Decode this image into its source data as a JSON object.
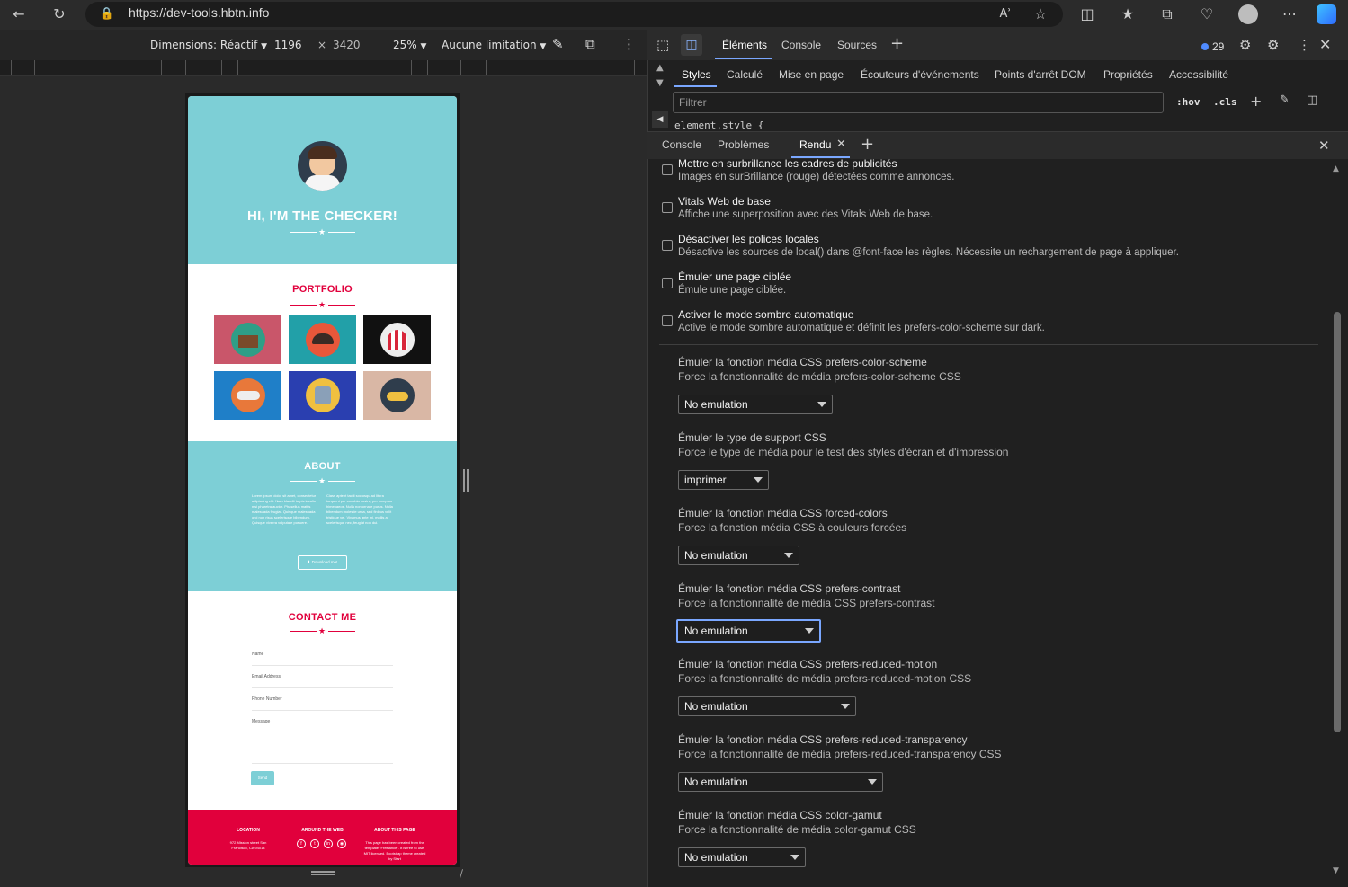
{
  "browser": {
    "url": "https://dev-tools.hbtn.info"
  },
  "device_toolbar": {
    "dimensions_label": "Dimensions: Réactif",
    "width": "1196",
    "times": "×",
    "height": "3420",
    "zoom": "25%",
    "throttle": "Aucune limitation"
  },
  "page": {
    "hero_title": "HI, I'M THE CHECKER!",
    "portfolio_title": "PORTFOLIO",
    "about_title": "ABOUT",
    "about_col1": "Lorem ipsum dolor sit amet, consectetur adipiscing elit. Nam blandit turpis iaculis nisi pharetra auctor. Phasellus mattis malesuada feugiat. Quisque malesuada orci non risus scelerisque bibendum. Quisque viverra vulputate posuere.",
    "about_col2": "Class aptent taciti sociosqu ad litora torquent per conubia nostra, per inceptos himenaeos. Nulla non ornare purus. Nulla bibendum molestie urna, sed finibus velit tristique vel. Vivamus ante mi, mollis at scelerisque nec, feugiat non dui.",
    "download_label": "Download me!",
    "contact_title": "CONTACT ME",
    "field_name": "Name",
    "field_email": "Email Address",
    "field_phone": "Phone Number",
    "field_message": "Message",
    "send_label": "Send",
    "footer_location_title": "LOCATION",
    "footer_location_text": "972 Mission street San Francisco, CA 94014",
    "footer_web_title": "AROUND THE WEB",
    "footer_about_title": "ABOUT THIS PAGE",
    "footer_about_text": "This page has been created from the template \"Freelance\". It is free to use, MIT licensed. Bootstrap theme created by Start"
  },
  "devtools": {
    "top_tabs": [
      "Éléments",
      "Console",
      "Sources"
    ],
    "issues_count": "29",
    "panel_tabs": [
      "Styles",
      "Calculé",
      "Mise en page",
      "Écouteurs d'événements",
      "Points d'arrêt DOM",
      "Propriétés",
      "Accessibilité"
    ],
    "filter_placeholder": "Filtrer",
    "hov": ":hov",
    "cls": ".cls",
    "element_style": "element.style {",
    "drawer_tabs": [
      "Console",
      "Problèmes",
      "Rendu"
    ],
    "checkbox_options": [
      {
        "title": "Mettre en surbrillance les cadres de publicités",
        "desc": "Images en surBrillance (rouge) détectées comme annonces."
      },
      {
        "title": "Vitals Web de base",
        "desc": "Affiche une superposition avec des Vitals Web de base."
      },
      {
        "title": "Désactiver les polices locales",
        "desc": "Désactive les sources de local() dans @font-face les règles. Nécessite un rechargement de page à appliquer."
      },
      {
        "title": "Émuler une page ciblée",
        "desc": "Émule une page ciblée."
      },
      {
        "title": "Activer le mode sombre automatique",
        "desc": "Active le mode sombre automatique et définit les prefers-color-scheme sur dark."
      }
    ],
    "emulations": [
      {
        "title": "Émuler la fonction média CSS prefers-color-scheme",
        "desc": "Force la fonctionnalité de média prefers-color-scheme CSS",
        "value": "No emulation"
      },
      {
        "title": "Émuler le type de support CSS",
        "desc": "Force le type de média pour le test des styles d'écran et d'impression",
        "value": "imprimer"
      },
      {
        "title": "Émuler la fonction média CSS forced-colors",
        "desc": "Force la fonction média CSS à couleurs forcées",
        "value": "No emulation"
      },
      {
        "title": "Émuler la fonction média CSS prefers-contrast",
        "desc": "Force la fonctionnalité de média CSS prefers-contrast",
        "value": "No emulation"
      },
      {
        "title": "Émuler la fonction média CSS prefers-reduced-motion",
        "desc": "Force la fonctionnalité de média prefers-reduced-motion CSS",
        "value": "No emulation"
      },
      {
        "title": "Émuler la fonction média CSS prefers-reduced-transparency",
        "desc": "Force la fonctionnalité de média prefers-reduced-transparency CSS",
        "value": "No emulation"
      },
      {
        "title": "Émuler la fonction média CSS color-gamut",
        "desc": "Force la fonctionnalité de média color-gamut CSS",
        "value": "No emulation"
      }
    ]
  },
  "colors": {
    "teal": "#7dcfd6",
    "crimson": "#e1003c",
    "accent_blue": "#7aa7ff"
  }
}
